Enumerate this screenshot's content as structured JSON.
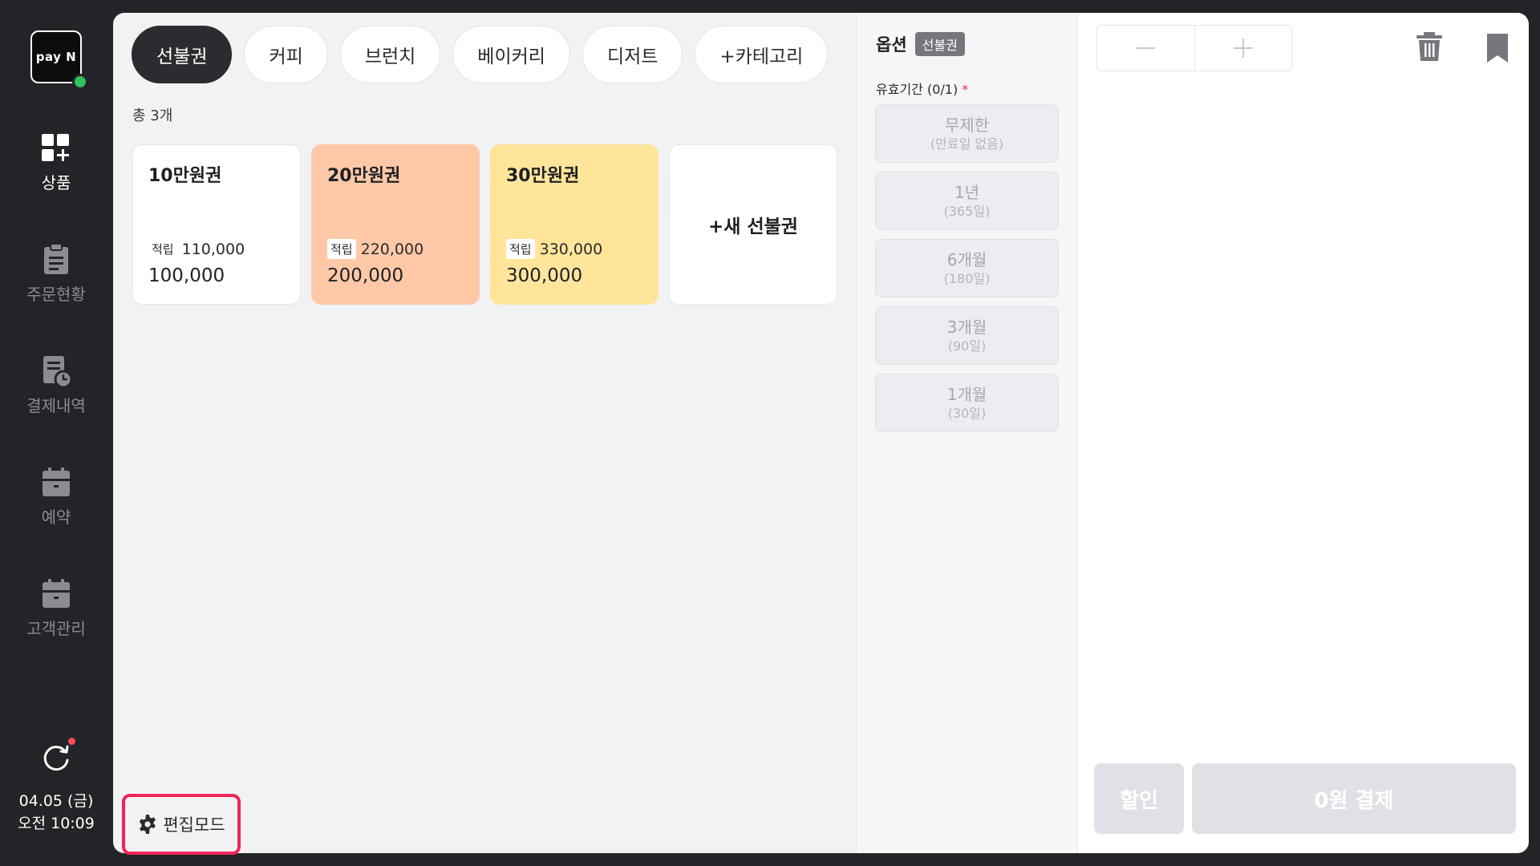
{
  "sidebar": {
    "logo_text": "pay N",
    "items": [
      {
        "label": "상품",
        "icon": "grid-plus-icon",
        "active": true
      },
      {
        "label": "주문현황",
        "icon": "clipboard-icon",
        "active": false
      },
      {
        "label": "결제내역",
        "icon": "receipt-clock-icon",
        "active": false
      },
      {
        "label": "예약",
        "icon": "calendar-icon",
        "active": false
      },
      {
        "label": "고객관리",
        "icon": "calendar-icon",
        "active": false
      }
    ],
    "date": "04.05 (금)",
    "time": "오전 10:09"
  },
  "catalog": {
    "tabs": [
      {
        "label": "선불권",
        "active": true
      },
      {
        "label": "커피",
        "active": false
      },
      {
        "label": "브런치",
        "active": false
      },
      {
        "label": "베이커리",
        "active": false
      },
      {
        "label": "디저트",
        "active": false
      },
      {
        "label": "+카테고리",
        "active": false
      }
    ],
    "count_text": "총 3개",
    "cards": [
      {
        "name": "10만원권",
        "points_label": "적립",
        "points": "110,000",
        "price": "100,000",
        "color": "#ffffff"
      },
      {
        "name": "20만원권",
        "points_label": "적립",
        "points": "220,000",
        "price": "200,000",
        "color": "#ffc9a8"
      },
      {
        "name": "30만원권",
        "points_label": "적립",
        "points": "330,000",
        "price": "300,000",
        "color": "#ffe59a"
      }
    ],
    "new_card_label": "+새 선불권",
    "edit_mode_label": "편집모드"
  },
  "options": {
    "title": "옵션",
    "tag": "선불권",
    "subtitle": "유효기간 (0/1)",
    "required_mark": "*",
    "items": [
      {
        "l1": "무제한",
        "l2": "(만료일 없음)"
      },
      {
        "l1": "1년",
        "l2": "(365일)"
      },
      {
        "l1": "6개월",
        "l2": "(180일)"
      },
      {
        "l1": "3개월",
        "l2": "(90일)"
      },
      {
        "l1": "1개월",
        "l2": "(30일)"
      }
    ]
  },
  "cart": {
    "discount_label": "할인",
    "pay_label": "0원 결제"
  },
  "colors": {
    "accent_highlight": "#f0245a",
    "status_online": "#2fc25b",
    "notify_dot": "#ff4b55"
  }
}
